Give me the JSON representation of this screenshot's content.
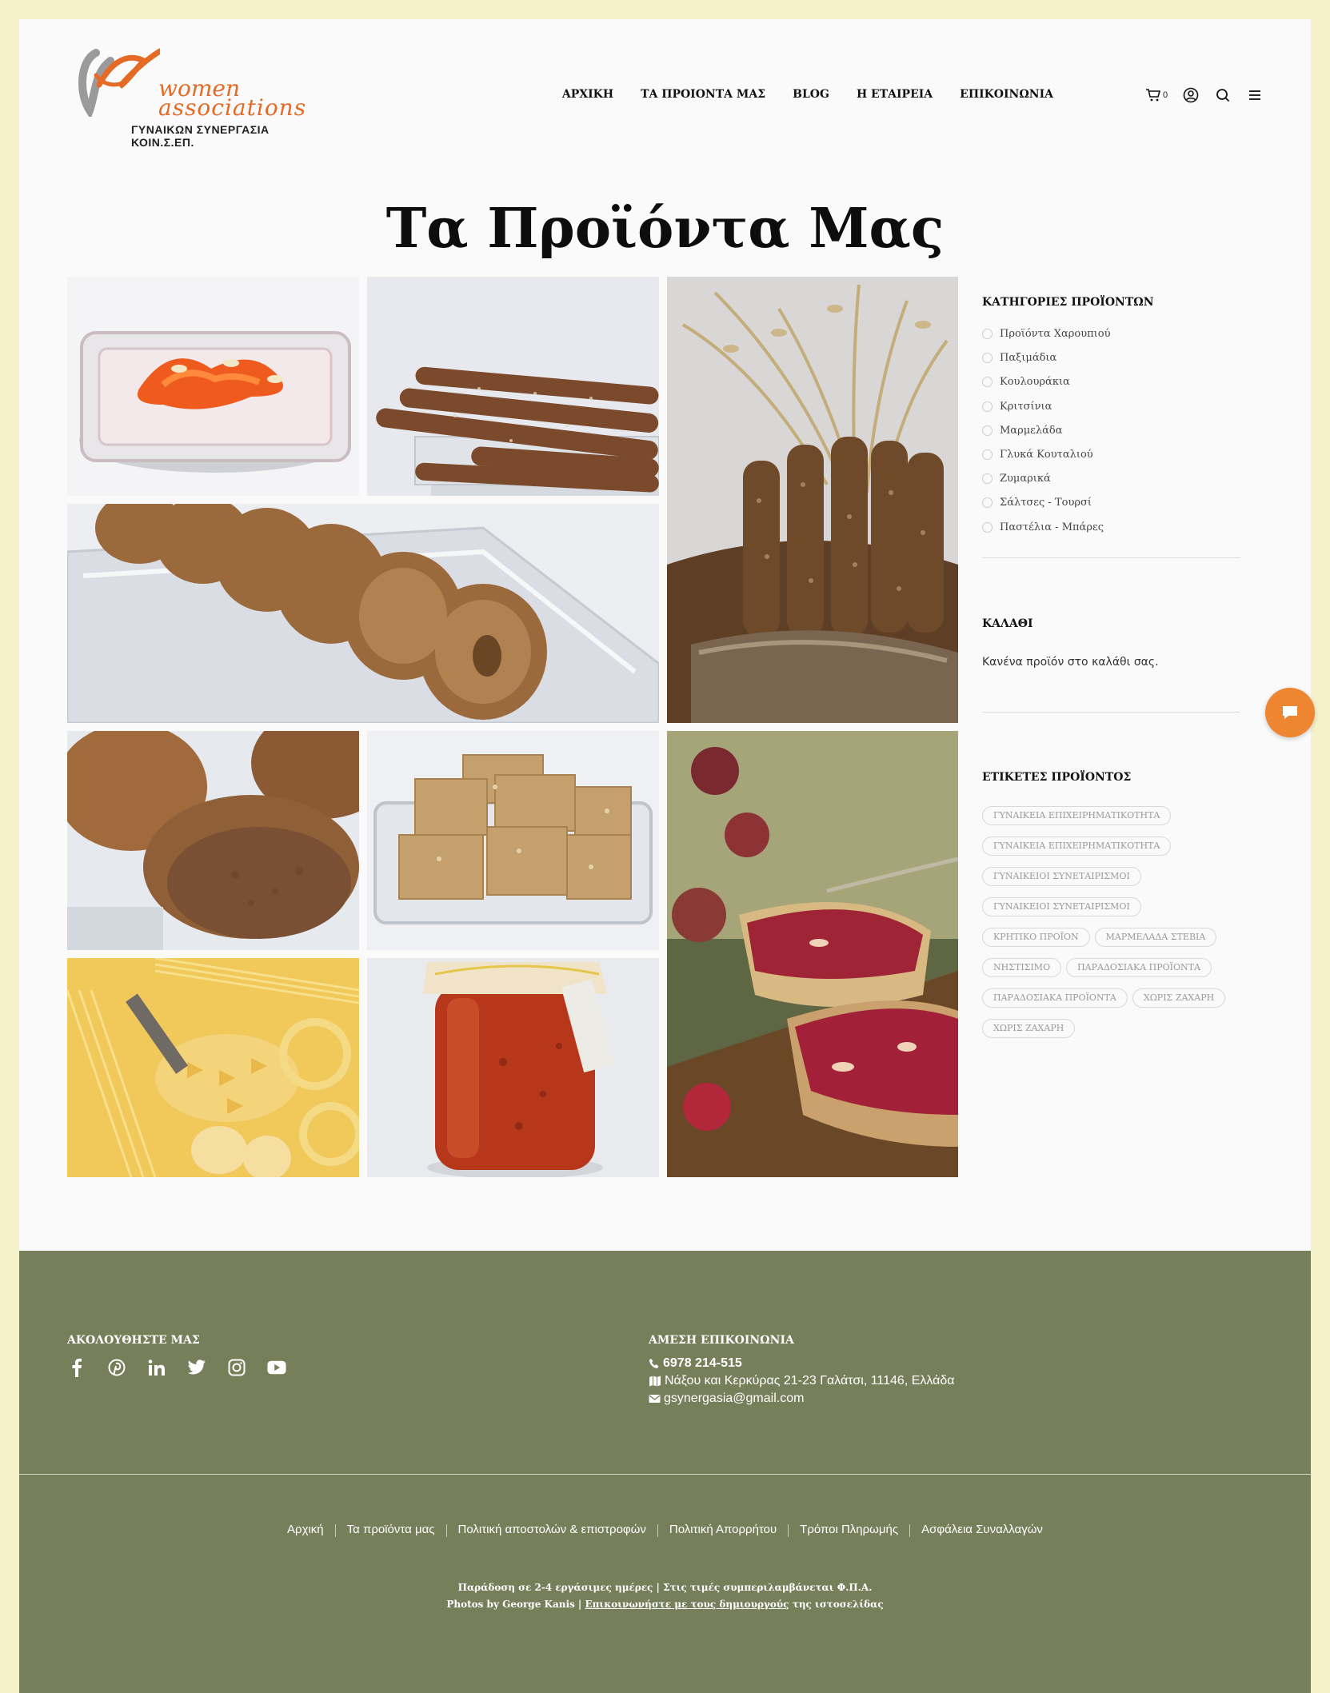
{
  "header": {
    "logo": {
      "line1": "women",
      "line2": "associations",
      "tagline": "ΓΥΝΑΙΚΩΝ ΣΥΝΕΡΓΑΣΙΑ ΚΟΙΝ.Σ.ΕΠ."
    },
    "nav": [
      "ΑΡΧΙΚΗ",
      "ΤΑ ΠΡΟΙΟΝΤΑ ΜΑΣ",
      "BLOG",
      "Η ΕΤΑΙΡΕΙΑ",
      "ΕΠΙΚΟΙΝΩΝΙΑ"
    ],
    "cart_count": "0",
    "icons": [
      "cart-icon",
      "user-icon",
      "search-icon",
      "menu-icon"
    ]
  },
  "page_title": "Τα Προϊόντα Μας",
  "gallery": [
    "candied-fruit",
    "breadsticks",
    "rusks-basket",
    "koulourakia",
    "bread-rolls",
    "pasteli-bars",
    "jam-toast",
    "pasta",
    "sauce-jar"
  ],
  "sidebar": {
    "categories_title": "ΚΑΤΗΓΟΡΙΕΣ ΠΡΟΪΟΝΤΩΝ",
    "categories": [
      "Προϊόντα Χαρουπιού",
      "Παξιμάδια",
      "Κουλουράκια",
      "Κριτσίνια",
      "Μαρμελάδα",
      "Γλυκά Κουταλιού",
      "Ζυμαρικά",
      "Σάλτσες - Τουρσί",
      "Παστέλια - Μπάρες"
    ],
    "cart_title": "ΚΑΛΑΘΙ",
    "cart_empty": "Κανένα προϊόν στο καλάθι σας.",
    "tags_title": "ΕΤΙΚΕΤΕΣ ΠΡΟΪΟΝΤΟΣ",
    "tags": [
      "ΓΥΝΑΙΚΕΙΑ ΕΠΙΧΕΙΡΗΜΑΤΙΚΟΤΗΤΑ",
      "ΓΥΝΑΙΚΕΙΑ ΕΠΙΧΕΙΡΗΜΑΤΙΚΟΤΗΤΑ",
      "ΓΥΝΑΙΚΕΙΟΙ ΣΥΝΕΤΑΙΡΙΣΜΟΙ",
      "ΓΥΝΑΙΚΕΙΟΙ ΣΥΝΕΤΑΙΡΙΣΜΟΙ",
      "ΚΡΗΤΙΚΟ ΠΡΟΪΟΝ",
      "ΜΑΡΜΕΛΑΔΑ ΣΤΕΒΙΑ",
      "ΝΗΣΤΙΣΙΜΟ",
      "ΠΑΡΑΔΟΣΙΑΚΑ ΠΡΟΪΟΝΤΑ",
      "ΠΑΡΑΔΟΣΙΑΚΑ ΠΡΟΪΟΝΤΑ",
      "ΧΩΡΙΣ ΖΑΧΑΡΗ",
      "ΧΩΡΙΣ ΖΑΧΑΡΗ"
    ]
  },
  "footer": {
    "follow_title": "ΑΚΟΛΟΥΘΗΣΤΕ ΜΑΣ",
    "social": [
      "facebook-icon",
      "pinterest-icon",
      "linkedin-icon",
      "twitter-icon",
      "instagram-icon",
      "youtube-icon"
    ],
    "contact_title": "ΑΜΕΣΗ ΕΠΙΚΟΙΝΩΝΙΑ",
    "phone": "6978 214-515",
    "address": "Νάξου και Κερκύρας 21-23 Γαλάτσι, 11146, Ελλάδα",
    "email": "gsynergasia@gmail.com",
    "links": [
      "Αρχική",
      "Τα προϊόντα μας",
      "Πολιτική αποστολών & επιστροφών",
      "Πολιτική Απορρήτου",
      "Τρόποι Πληρωμής",
      "Ασφάλεια Συναλλαγών"
    ],
    "delivery_note": "Παράδοση σε 2-4 εργάσιμες ημέρες | Στις τιμές συμπεριλαμβάνεται Φ.Π.Α.",
    "credits_prefix": "Photos by George Kanis | ",
    "credits_link": "Επικοινωνήστε με τους δημιουργούς",
    "credits_suffix": " της ιστοσελίδας"
  },
  "colors": {
    "page_bg": "#f5f1c9",
    "footer_bg": "#767e5a",
    "accent": "#e46a25",
    "chat": "#ee8531"
  }
}
